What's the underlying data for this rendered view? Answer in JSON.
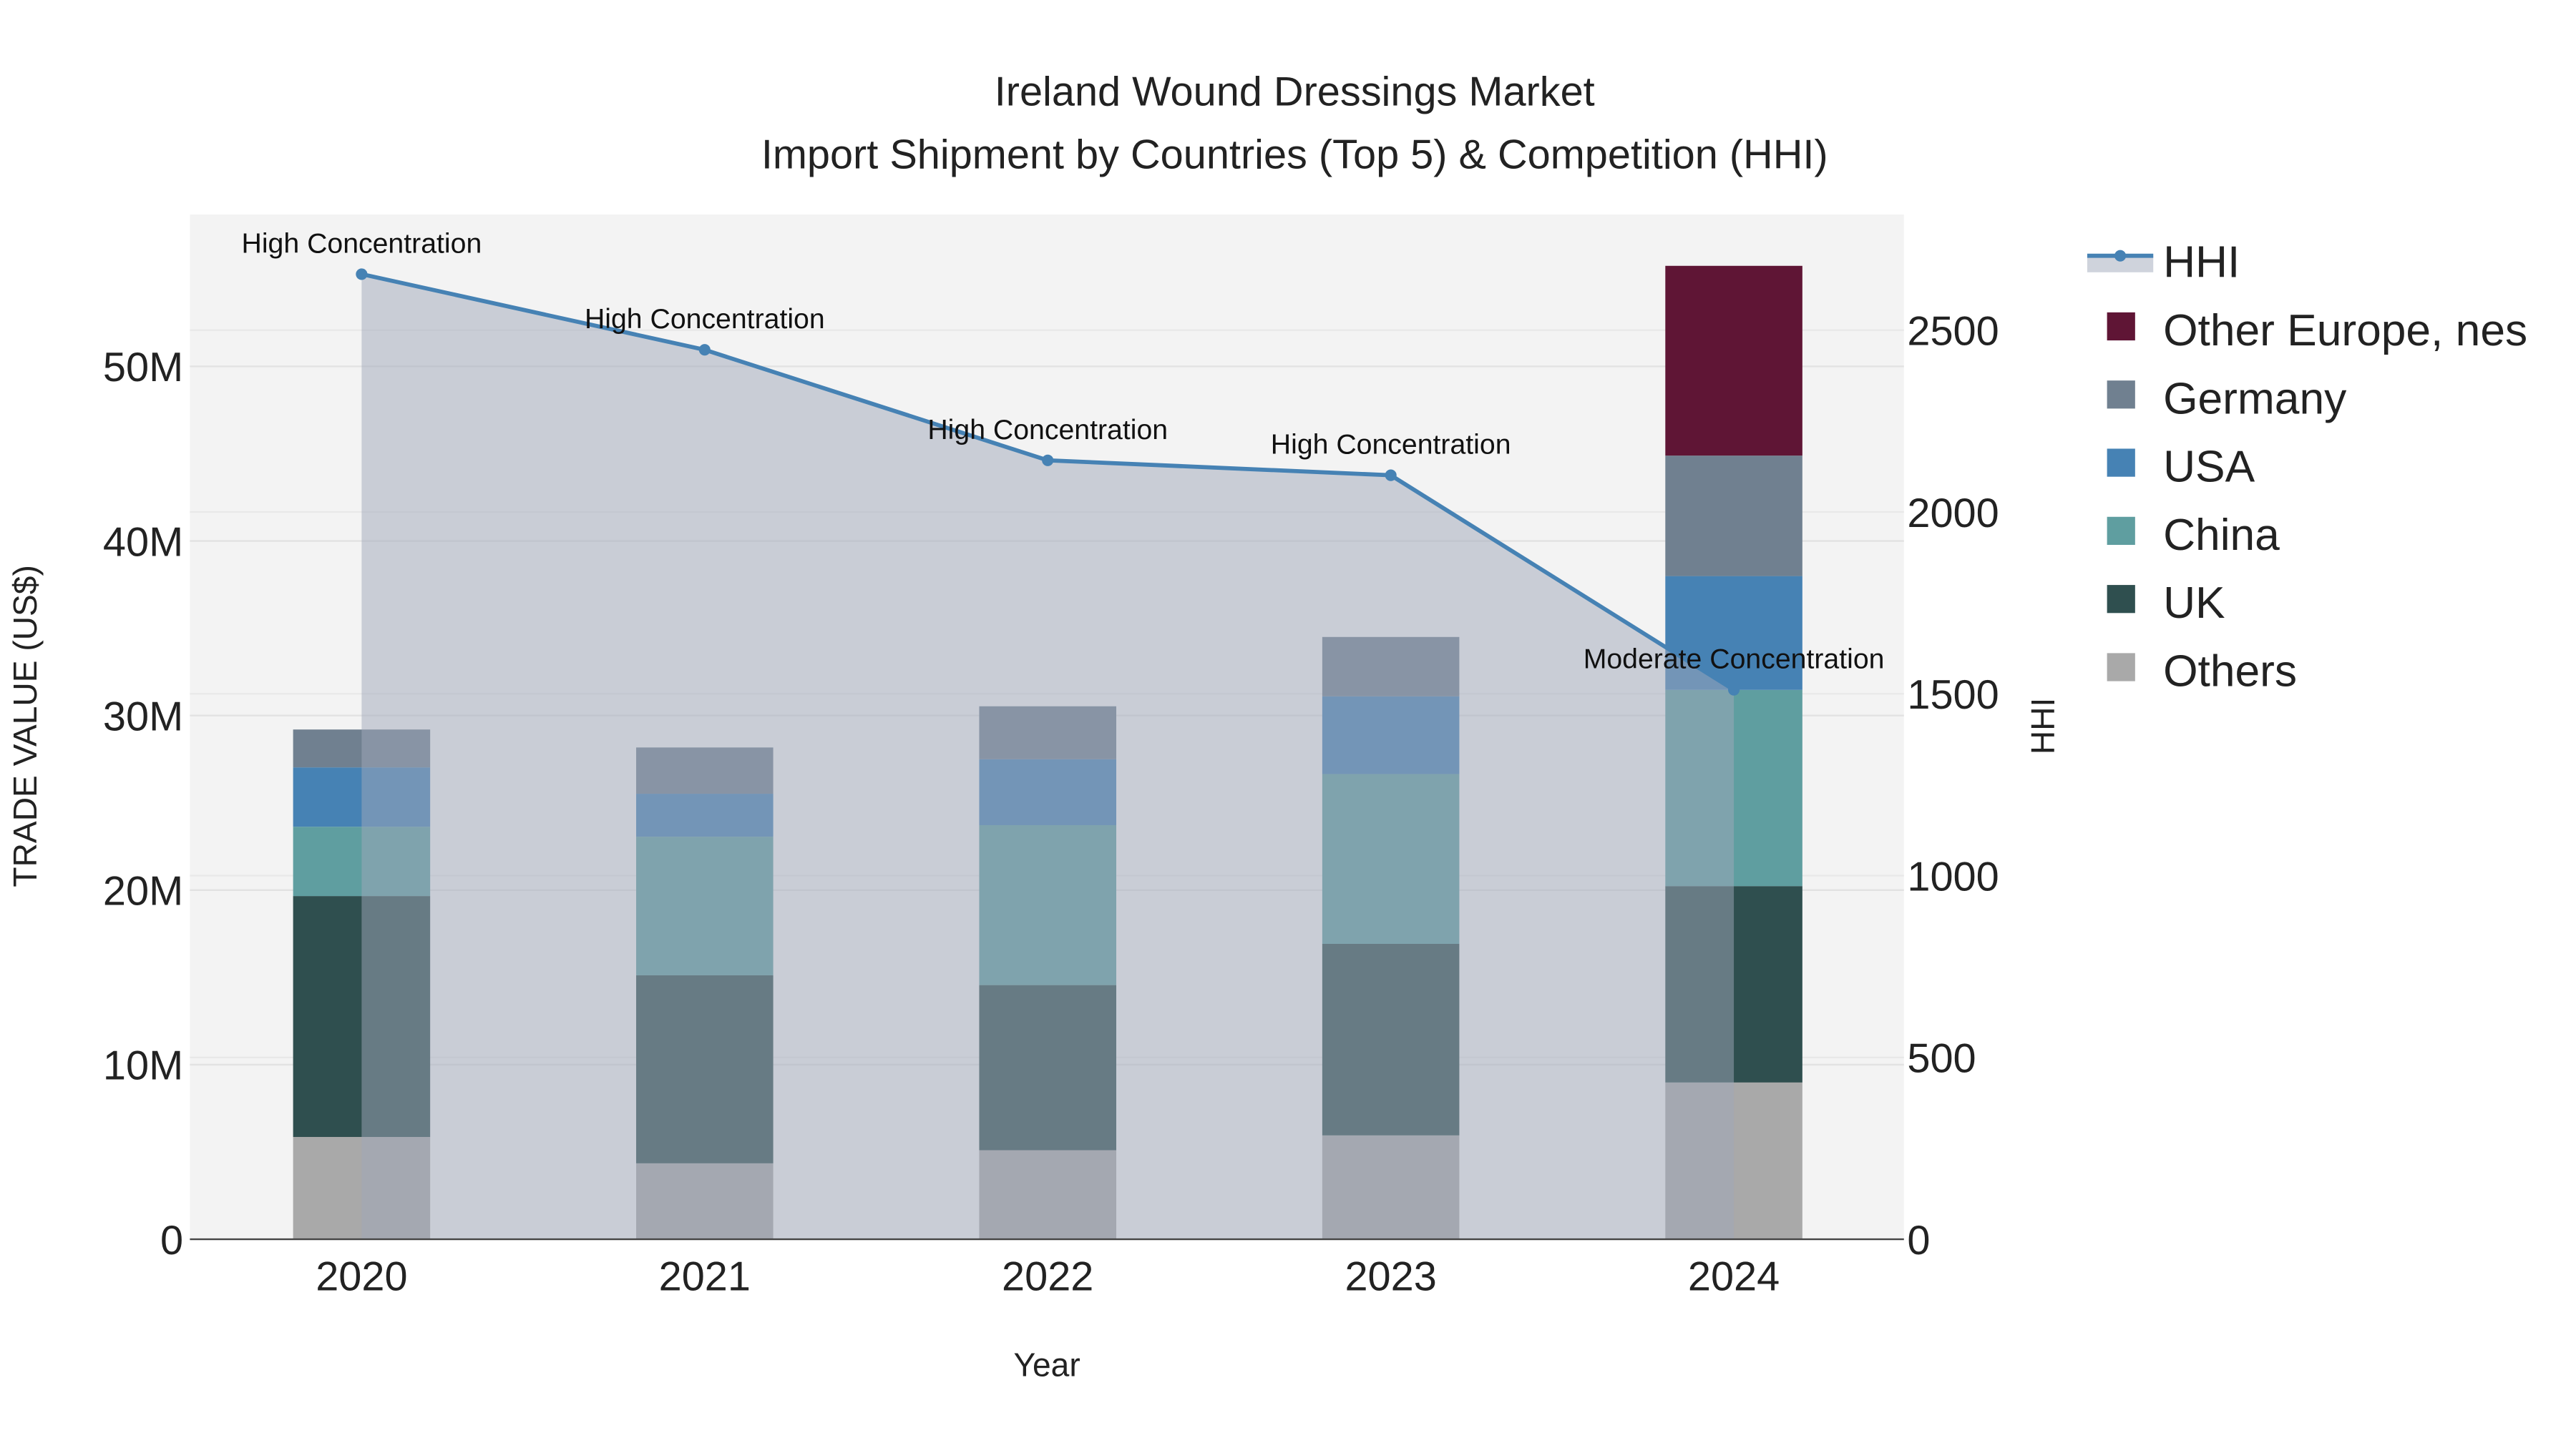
{
  "chart_data": {
    "type": "bar",
    "title_line1": "Ireland Wound Dressings Market",
    "title_line2": "Import Shipment by Countries (Top 5) & Competition (HHI)",
    "xlabel": "Year",
    "ylabel": "TRADE VALUE (US$)",
    "y2label": "HHI",
    "categories": [
      "2020",
      "2021",
      "2022",
      "2023",
      "2024"
    ],
    "ylim": [
      0,
      58700000
    ],
    "y2lim": [
      0,
      2818
    ],
    "yticks": [
      {
        "v": 0,
        "label": "0"
      },
      {
        "v": 10000000,
        "label": "10M"
      },
      {
        "v": 20000000,
        "label": "20M"
      },
      {
        "v": 30000000,
        "label": "30M"
      },
      {
        "v": 40000000,
        "label": "40M"
      },
      {
        "v": 50000000,
        "label": "50M"
      }
    ],
    "y2ticks": [
      {
        "v": 0,
        "label": "0"
      },
      {
        "v": 500,
        "label": "500"
      },
      {
        "v": 1000,
        "label": "1000"
      },
      {
        "v": 1500,
        "label": "1500"
      },
      {
        "v": 2000,
        "label": "2000"
      },
      {
        "v": 2500,
        "label": "2500"
      }
    ],
    "series": [
      {
        "name": "Others",
        "color": "#a9a9a9",
        "values": [
          5860000,
          4350000,
          5100000,
          5950000,
          8980000
        ]
      },
      {
        "name": "UK",
        "color": "#2f4f4f",
        "values": [
          13800000,
          10770000,
          9460000,
          10970000,
          11250000
        ]
      },
      {
        "name": "China",
        "color": "#5f9ea0",
        "values": [
          3970000,
          7940000,
          9160000,
          9730000,
          11240000
        ]
      },
      {
        "name": "USA",
        "color": "#4682b4",
        "values": [
          3400000,
          2460000,
          3780000,
          4450000,
          6520000
        ]
      },
      {
        "name": "Germany",
        "color": "#708090",
        "values": [
          2170000,
          2650000,
          3030000,
          3400000,
          6900000
        ]
      },
      {
        "name": "Other Europe, nes",
        "color": "#5f1535",
        "values": [
          0,
          0,
          0,
          0,
          10870000
        ]
      }
    ],
    "hhi": {
      "name": "HHI",
      "color": "#4682b4",
      "values": [
        2654,
        2446,
        2142,
        2101,
        1511
      ],
      "annotations": [
        "High Concentration",
        "High Concentration",
        "High Concentration",
        "High Concentration",
        "Moderate Concentration"
      ]
    },
    "legend": [
      "HHI",
      "Other Europe, nes",
      "Germany",
      "USA",
      "China",
      "UK",
      "Others"
    ],
    "legend_position": "right",
    "grid": true
  }
}
